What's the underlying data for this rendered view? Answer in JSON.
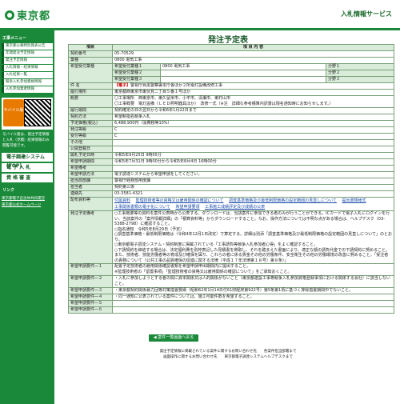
{
  "header": {
    "logo": "東京都",
    "service": "入札情報サービス"
  },
  "sidebar": {
    "menu_label": "工事メニュー",
    "items": [
      "東京都公報特別発表公告",
      "年間発注予定情報",
      "発注予定情報",
      "入札情報・結果情報",
      "入札結果一覧",
      "競争入札参加資格情報",
      "入札参加業者情報"
    ],
    "mobile_label": "モバイル版",
    "mobile_note": "モバイル版は、発注予定情報と入札（見積）結果情報のみ閲覧可能です。",
    "big_buttons": [
      "電子調達システム(TOP)",
      "電 子 入 札",
      "資 格 審 査"
    ],
    "links_label": "リンク",
    "links": [
      "東京都電子自治体共同運営",
      "東京都公式ホームページ"
    ]
  },
  "page_title": "発注予定表",
  "table": {
    "col_item": "項目",
    "col_content": "項 目 内 容",
    "contract_no_label": "契約番号",
    "contract_no": "05-70529",
    "industry_label": "業種",
    "industry": "0800 電気工事",
    "industry_rows": [
      {
        "label": "希望受付業種１",
        "value": "0800 電気工事",
        "side_label": "分野１",
        "side": ""
      },
      {
        "label": "希望受付業種２",
        "value": "",
        "side_label": "分野２",
        "side": ""
      },
      {
        "label": "希望受付業種３",
        "value": "",
        "side_label": "分野３",
        "side": ""
      }
    ],
    "hope_industry_label": "希望受付業種",
    "subject_label": "件 名",
    "subject_tag": "【電子】",
    "subject": "警視庁目黒警察署本庁舎ほか２所電灯設備改修工事",
    "place_label": "履行場所",
    "place": "東京都西東京市東伏見二丁目５番１号ほか",
    "summary_label": "概要",
    "summary": [
      "〇工事場所　西東京市、東久留米市、小平市、清瀬市、東村山市",
      "〇工事概要　電灯設備（ＬＥＤ照明器具ほか）　改修一式（※注　詳細な参考積算内訳書は現名通知時にお知らせします。）"
    ],
    "period_label": "履行期間",
    "period": "契約確定の日の翌日から令和6年1月22日まで",
    "method_label": "契約方法",
    "method": "希望制指名競争入札",
    "price_label": "予定価格(税込)",
    "price": "6,488,900円（消費税等10%）",
    "ordering_label": "発注等級",
    "ordering": "C",
    "grade_label": "受付等級",
    "grade": "C",
    "other_label": "その他",
    "other": "",
    "amend_label": "公開登載日",
    "amend": "",
    "open_label": "開札予定日時",
    "open": "令和5年9月25日 9時05分",
    "apply_label": "希望申請期間",
    "apply": "令和5年7月31日 9時00分から令和5年8月4日 16時00分",
    "notes_label": "希望備考",
    "notes": "",
    "method2_label": "希望申請方法",
    "method2": "電子調達システムから希望申請をしてください。",
    "dept_label": "担当局部課",
    "dept": "警視庁経務部用度課",
    "person_label": "担当者",
    "person": "契約第三係",
    "tel_label": "連絡先",
    "tel": "03-3581-4321",
    "files_label": "配布資料等",
    "files": [
      "付属資料",
      "監理技術者等の資格又は雇用関係の確認について",
      "調査基準価格及び最低制限価格の設定範囲の見直しについて",
      "提出書類様式",
      "工事関係書類の電子化について",
      "希望申請要領",
      "工事施工成績評定及び成績の公表"
    ],
    "details_label": "発注予定備考",
    "details": [
      "○工事概要等の資料を案件公表時から公表する。ダウンロードは、当該案件に参加できる者のみが行うことができる。ICカードで電子入札にログインを行い、当該案件の「案件情報詳細」の「積算資料等」からダウンロードすること。なお、操作方法については不明な点がある場合は、ヘルプデスク（03-5388-2798）に確認すること。",
      "○指名通知　令和5年8月29日（予定）",
      "○調査基準価格・最低制限価格は（令和4年12月1日改定）で算定する。詳細は別添「調査基準価格及び最低制限価格の設定範囲の見直しについて」のとおり。",
      "○東京都電子調達システム・契約制度に掲載されている「工事請負等競争入札参加者心得」をよく確認すること。",
      "○下請契約を締結する場合は、法定福利費を別枠表記した見積書を徴取し、それを踏まえた書面により、適正な額の請負代金での下請契約に努めること。また、技術者、技能労働者等の育成及び確保を図り、これらの者に係る賃金その他の労働条件、安全衛生その他の労働環境の改善に努めること。「受注者の責務について（公共工事の品質確保の促進に関する法律（平成１７年法律第１８号）第８条）」"
    ],
    "req1_label": "希望申請要件―１",
    "req1": "配置予定技術者の雇用関係確認書類を希望申請申出期間内に提出すること。\n※監理技術者の「留置事項」「監理技術者の資格又は雇用関係の確認について」をご承知おくこと。",
    "req2_label": "希望申請要件―２",
    "req2": "・入札に参加しようとする者の間に資本関係又は人的関係がないこと（東京都建設工事等競争入札参加資格登録事項における関係する会社）に該当しないこと。",
    "req3_label": "希望申請要件―３",
    "req3": "・東京都契約関係暴力団等対策措置要綱（昭和62年1月14日付61財経庶第922号）第5条第1項に基づく排除措置期間中でないこと。",
    "req4_label": "希望申請要件―４",
    "req4": "・同一通知に公表されている案件については、施工可能件数を希望すること。",
    "req5_label": "希望申請要件―５",
    "req5": "",
    "req6_label": "希望申請要件―６",
    "req6": ""
  },
  "back_button": "案件一覧画面へ戻る",
  "footer": [
    "発注予定情報に掲載されている案件に関するお問い合わせ先　　各案件担当部署まで",
    "画面操作に関するお問い合わせ先　　東京都電子調達システムヘルプデスクまで"
  ]
}
